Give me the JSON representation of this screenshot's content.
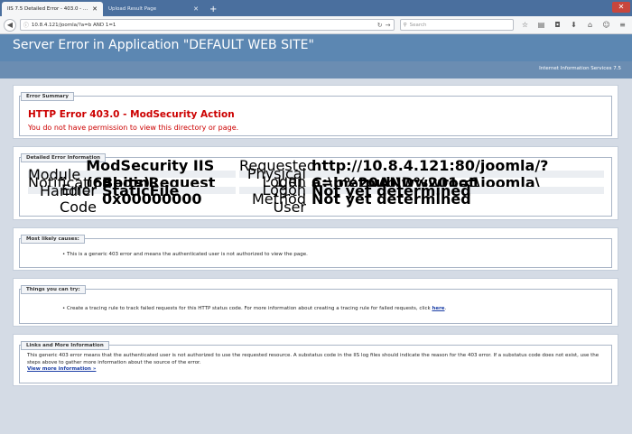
{
  "browser": {
    "tabs": [
      {
        "title": "IIS 7.5 Detailed Error - 403.0 - Mo...",
        "active": true
      },
      {
        "title": "Upload Result Page",
        "active": false
      }
    ],
    "new_tab": "+",
    "url": "10.8.4.121/joomla/?a=b AND 1=1",
    "search_placeholder": "Search"
  },
  "page": {
    "title": "Server Error in Application \"DEFAULT WEB SITE\"",
    "iis_version": "Internet Information Services 7.5"
  },
  "error_summary": {
    "legend": "Error Summary",
    "title": "HTTP Error 403.0 - ModSecurity Action",
    "message": "You do not have permission to view this directory or page."
  },
  "detailed_error": {
    "legend": "Detailed Error Information",
    "left": [
      {
        "label": "Module",
        "value": "ModSecurity IIS (64bits)"
      },
      {
        "label": "Notification",
        "value": "BeginRequest"
      },
      {
        "label": "Handler",
        "value": "StaticFile"
      },
      {
        "label": "Error Code",
        "value": "0x00000000"
      }
    ],
    "right": [
      {
        "label": "Requested URL",
        "value": "http://10.8.4.121:80/joomla/?a=b%20AND%201=1"
      },
      {
        "label": "Physical Path",
        "value": "C:\\inetpub\\wwwroot\\joomla\\"
      },
      {
        "label": "Logon Method",
        "value": "Not yet determined"
      },
      {
        "label": "Logon User",
        "value": "Not yet determined"
      }
    ]
  },
  "likely_causes": {
    "legend": "Most likely causes:",
    "item": "This is a generic 403 error and means the authenticated user is not authorized to view the page."
  },
  "things_to_try": {
    "legend": "Things you can try:",
    "item": "Create a tracing rule to track failed requests for this HTTP status code. For more information about creating a tracing rule for failed requests, click",
    "link": "here",
    "suffix": "."
  },
  "links_info": {
    "legend": "Links and More Information",
    "text": "This generic 403 error means that the authenticated user is not authorized to use the requested resource. A substatus code in the IIS log files should indicate the reason for the 403 error. If a substatus code does not exist, use the steps above to gather more information about the source of the error.",
    "link": "View more information »"
  }
}
